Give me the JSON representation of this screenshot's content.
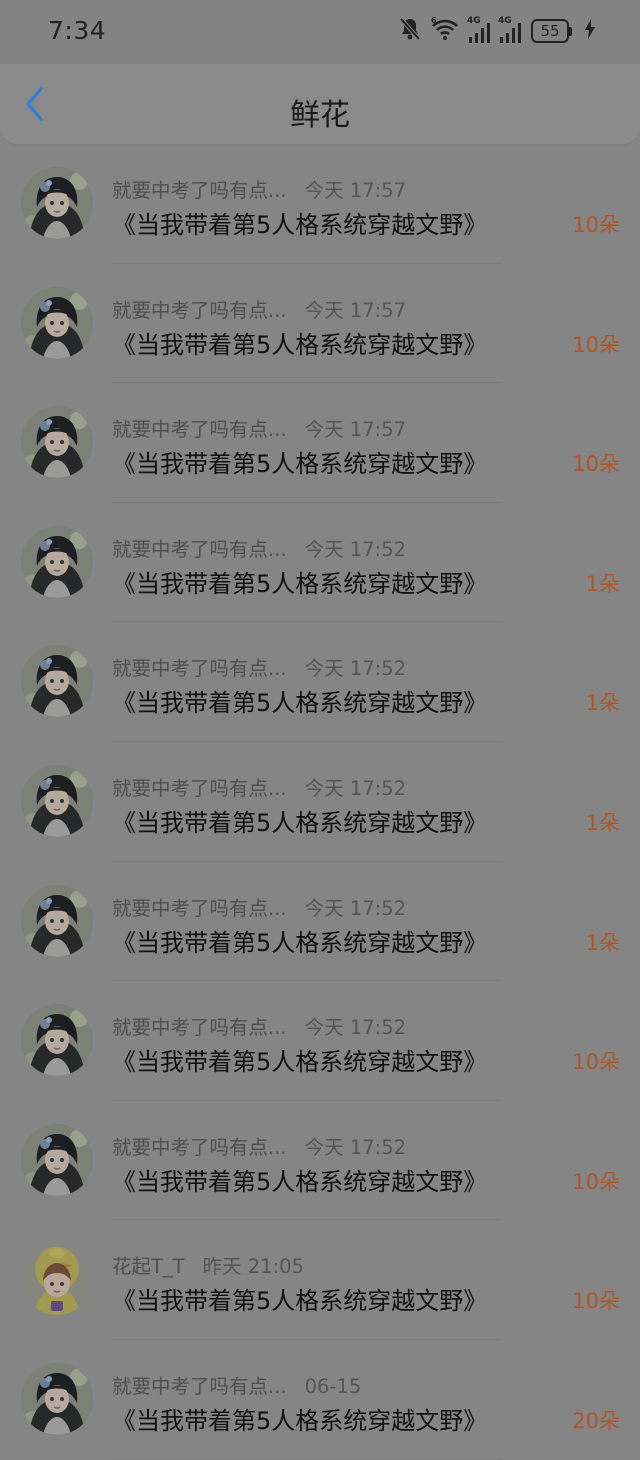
{
  "status_bar": {
    "time": "7:34",
    "battery": "55",
    "signal_label_1": "4G",
    "signal_label_2": "4G"
  },
  "header": {
    "title": "鲜花"
  },
  "icons": {
    "back": "chevron-left-icon",
    "mute": "bell-off-icon",
    "wifi": "wifi-icon",
    "signal": "signal-icon",
    "battery": "battery-icon",
    "charging": "bolt-icon"
  },
  "colors": {
    "back_accent": "#2b7fd3",
    "count": "#b0552a"
  },
  "items": [
    {
      "user": "就要中考了吗有点...",
      "time": "今天 17:57",
      "book": "《当我带着第5人格系统穿越文野》",
      "count": "10朵",
      "avatar": "gothic"
    },
    {
      "user": "就要中考了吗有点...",
      "time": "今天 17:57",
      "book": "《当我带着第5人格系统穿越文野》",
      "count": "10朵",
      "avatar": "gothic"
    },
    {
      "user": "就要中考了吗有点...",
      "time": "今天 17:57",
      "book": "《当我带着第5人格系统穿越文野》",
      "count": "10朵",
      "avatar": "gothic"
    },
    {
      "user": "就要中考了吗有点...",
      "time": "今天 17:52",
      "book": "《当我带着第5人格系统穿越文野》",
      "count": "1朵",
      "avatar": "gothic"
    },
    {
      "user": "就要中考了吗有点...",
      "time": "今天 17:52",
      "book": "《当我带着第5人格系统穿越文野》",
      "count": "1朵",
      "avatar": "gothic"
    },
    {
      "user": "就要中考了吗有点...",
      "time": "今天 17:52",
      "book": "《当我带着第5人格系统穿越文野》",
      "count": "1朵",
      "avatar": "gothic"
    },
    {
      "user": "就要中考了吗有点...",
      "time": "今天 17:52",
      "book": "《当我带着第5人格系统穿越文野》",
      "count": "1朵",
      "avatar": "gothic"
    },
    {
      "user": "就要中考了吗有点...",
      "time": "今天 17:52",
      "book": "《当我带着第5人格系统穿越文野》",
      "count": "10朵",
      "avatar": "gothic"
    },
    {
      "user": "就要中考了吗有点...",
      "time": "今天 17:52",
      "book": "《当我带着第5人格系统穿越文野》",
      "count": "10朵",
      "avatar": "gothic"
    },
    {
      "user": "花起T_T",
      "time": "昨天 21:05",
      "book": "《当我带着第5人格系统穿越文野》",
      "count": "10朵",
      "avatar": "duck"
    },
    {
      "user": "就要中考了吗有点...",
      "time": "06-15",
      "book": "《当我带着第5人格系统穿越文野》",
      "count": "20朵",
      "avatar": "gothic"
    }
  ]
}
